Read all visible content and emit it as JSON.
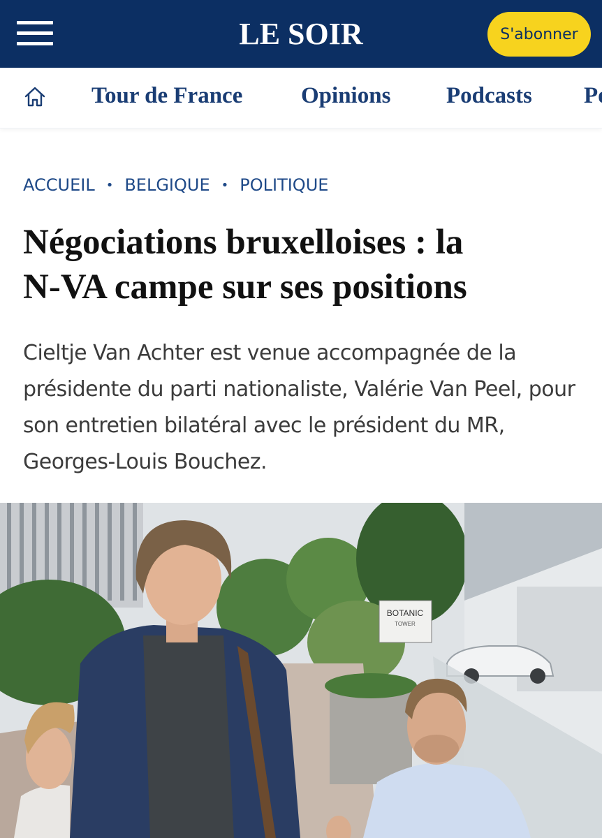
{
  "header": {
    "logo": "LE SOIR",
    "subscribe_label": "S'abonner"
  },
  "nav": {
    "items": [
      "Tour de France",
      "Opinions",
      "Podcasts",
      "Po"
    ]
  },
  "breadcrumb": {
    "items": [
      "ACCUEIL",
      "BELGIQUE",
      "POLITIQUE"
    ],
    "separator": "•"
  },
  "article": {
    "headline_line1": "Négociations bruxelloises : la",
    "headline_line2": "N-VA campe sur ses positions",
    "lead": "Cieltje Van Achter est venue accompagnée de la présidente du parti nationaliste, Valérie Van Peel, pour son entretien bilatéral avec le président du MR, Georges-Louis Bouchez."
  },
  "photo": {
    "sign_line1": "BOTANIC",
    "sign_line2": "TOWER"
  },
  "colors": {
    "brand_navy": "#0c2f63",
    "subscribe_yellow": "#f7d31e",
    "link_blue": "#1f4a88"
  }
}
